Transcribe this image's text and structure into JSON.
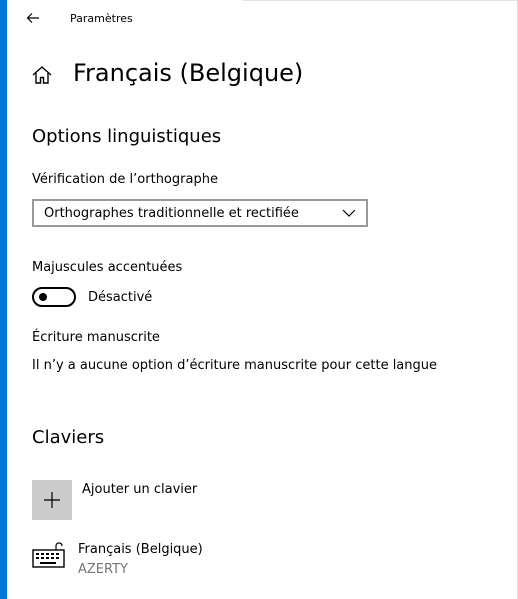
{
  "header": {
    "app_title": "Paramètres"
  },
  "page": {
    "title": "Français (Belgique)"
  },
  "language_options": {
    "heading": "Options linguistiques",
    "spellcheck": {
      "label": "Vérification de l’orthographe",
      "selected_value": "Orthographes traditionnelle et rectifiée"
    },
    "accented_caps": {
      "label": "Majuscules accentuées",
      "state_label": "Désactivé",
      "on": false
    },
    "handwriting": {
      "label": "Écriture manuscrite",
      "message": "Il n’y a aucune option d’écriture manuscrite pour cette langue"
    }
  },
  "keyboards": {
    "heading": "Claviers",
    "add_label": "Ajouter un clavier",
    "items": [
      {
        "name": "Français (Belgique)",
        "layout": "AZERTY",
        "icon": "keyboard-icon"
      }
    ]
  },
  "colors": {
    "accent": "#0078d7",
    "tile": "#cccccc",
    "muted_text": "#767676"
  }
}
